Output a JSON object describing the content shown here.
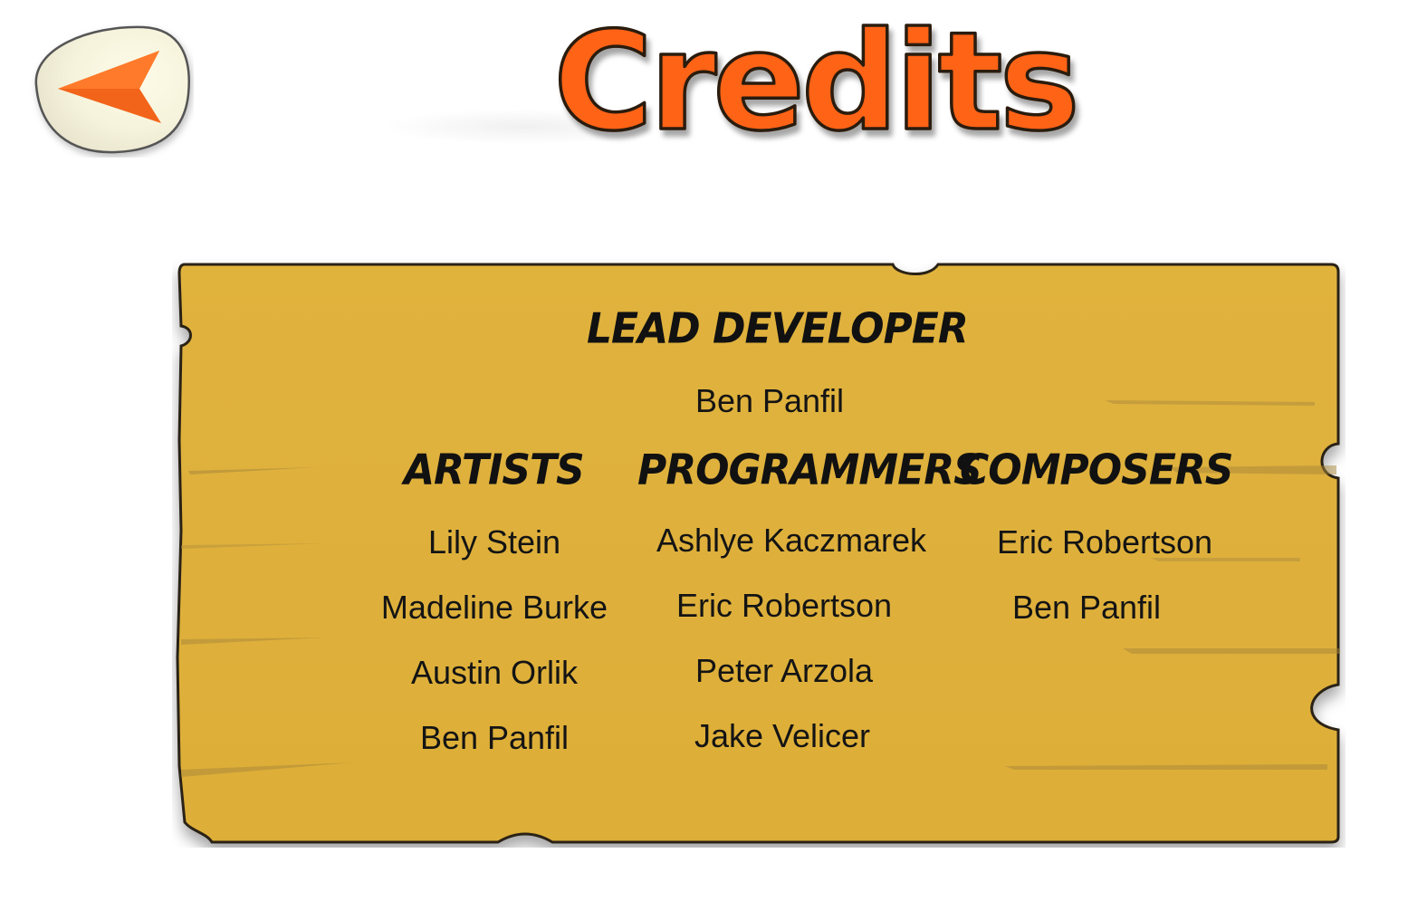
{
  "screen_title": "Credits",
  "back_button": {
    "icon": "arrow-left-icon"
  },
  "lead_developer": {
    "heading": "LEAD DEVELOPER",
    "names": [
      "Ben Panfil"
    ]
  },
  "artists": {
    "heading": "ARTISTS",
    "names": [
      "Lily Stein",
      "Madeline Burke",
      "Austin Orlik",
      "Ben Panfil"
    ]
  },
  "programmers": {
    "heading": "PROGRAMMERS",
    "names": [
      "Ashlye Kaczmarek",
      "Eric Robertson",
      "Peter Arzola",
      "Jake Velicer"
    ]
  },
  "composers": {
    "heading": "COMPOSERS",
    "names": [
      "Eric Robertson",
      "Ben Panfil"
    ]
  },
  "colors": {
    "title_orange": "#ff6418",
    "board_yellow": "#dfb23c",
    "arrow_orange": "#f26419"
  }
}
